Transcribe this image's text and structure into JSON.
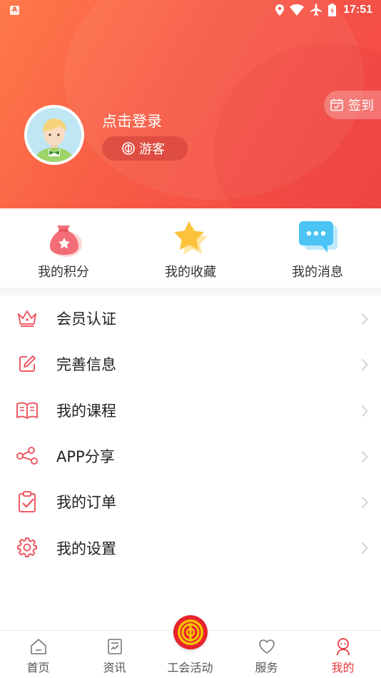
{
  "status_bar": {
    "time": "17:51",
    "app_badge": "A"
  },
  "header": {
    "login_text": "点击登录",
    "user_type": "游客",
    "checkin_label": "签到"
  },
  "quick_actions": [
    {
      "label": "我的积分",
      "icon": "money-bag-icon"
    },
    {
      "label": "我的收藏",
      "icon": "star-icon"
    },
    {
      "label": "我的消息",
      "icon": "chat-bubble-icon"
    }
  ],
  "menu": [
    {
      "label": "会员认证",
      "icon": "crown-icon"
    },
    {
      "label": "完善信息",
      "icon": "edit-icon"
    },
    {
      "label": "我的课程",
      "icon": "book-icon"
    },
    {
      "label": "APP分享",
      "icon": "share-icon"
    },
    {
      "label": "我的订单",
      "icon": "clipboard-check-icon"
    },
    {
      "label": "我的设置",
      "icon": "gear-icon"
    }
  ],
  "bottom_nav": [
    {
      "label": "首页",
      "icon": "home-icon",
      "active": false
    },
    {
      "label": "资讯",
      "icon": "news-icon",
      "active": false
    },
    {
      "label": "工会活动",
      "icon": "union-emblem-icon",
      "active": false
    },
    {
      "label": "服务",
      "icon": "heart-icon",
      "active": false
    },
    {
      "label": "我的",
      "icon": "profile-icon",
      "active": true
    }
  ],
  "colors": {
    "accent": "#e8383d",
    "header_start": "#ff7a4a",
    "header_end": "#f24747"
  }
}
